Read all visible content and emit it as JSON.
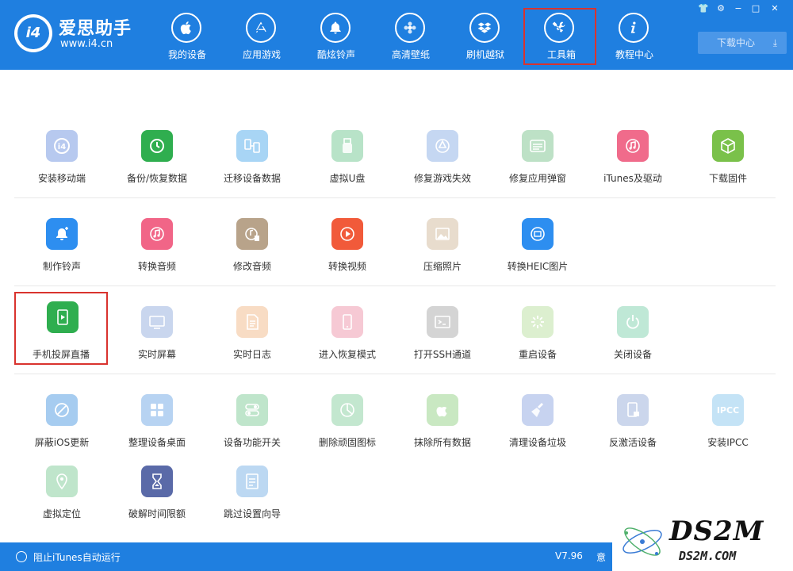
{
  "app": {
    "brand_name": "爱思助手",
    "brand_url": "www.i4.cn",
    "logo_text": "i4"
  },
  "nav": {
    "items": [
      {
        "label": "我的设备",
        "icon": "apple-icon"
      },
      {
        "label": "应用游戏",
        "icon": "app-store-icon"
      },
      {
        "label": "酷炫铃声",
        "icon": "bell-icon"
      },
      {
        "label": "高清壁纸",
        "icon": "flower-icon"
      },
      {
        "label": "刷机越狱",
        "icon": "box-icon"
      },
      {
        "label": "工具箱",
        "icon": "tools-icon",
        "active": true
      },
      {
        "label": "教程中心",
        "icon": "info-icon"
      }
    ],
    "download_center": "下载中心",
    "download_arrow": "⤓"
  },
  "window": {
    "shirt": "👕",
    "gear": "⚙",
    "minimize": "−",
    "maximize": "□",
    "close": "✕"
  },
  "tools": {
    "row1": [
      {
        "label": "安装移动端",
        "color": "#b7c9ef"
      },
      {
        "label": "备份/恢复数据",
        "color": "#2fae4f"
      },
      {
        "label": "迁移设备数据",
        "color": "#a8d5f5"
      },
      {
        "label": "虚拟U盘",
        "color": "#b8e3c8"
      },
      {
        "label": "修复游戏失效",
        "color": "#c5d7f2"
      },
      {
        "label": "修复应用弹窗",
        "color": "#bde1c6"
      },
      {
        "label": "iTunes及驱动",
        "color": "#f06b8b"
      },
      {
        "label": "下载固件",
        "color": "#7ac14a"
      }
    ],
    "row2": [
      {
        "label": "制作铃声",
        "color": "#2d8ef0"
      },
      {
        "label": "转换音频",
        "color": "#f16587"
      },
      {
        "label": "修改音频",
        "color": "#b8a38a"
      },
      {
        "label": "转换视频",
        "color": "#f15a3a"
      },
      {
        "label": "压缩照片",
        "color": "#e8dccd"
      },
      {
        "label": "转换HEIC图片",
        "color": "#2d8ef0"
      }
    ],
    "row3": [
      {
        "label": "手机投屏直播",
        "color": "#2fae4f"
      },
      {
        "label": "实时屏幕",
        "color": "#c9d6ee"
      },
      {
        "label": "实时日志",
        "color": "#f8dcc4"
      },
      {
        "label": "进入恢复模式",
        "color": "#f6c9d4"
      },
      {
        "label": "打开SSH通道",
        "color": "#d4d4d4"
      },
      {
        "label": "重启设备",
        "color": "#dcefcf"
      },
      {
        "label": "关闭设备",
        "color": "#bfe8d6"
      }
    ],
    "row4": [
      {
        "label": "屏蔽iOS更新",
        "color": "#a6ccf0"
      },
      {
        "label": "整理设备桌面",
        "color": "#b7d3f2"
      },
      {
        "label": "设备功能开关",
        "color": "#bfe5cb"
      },
      {
        "label": "删除顽固图标",
        "color": "#c3e7cf"
      },
      {
        "label": "抹除所有数据",
        "color": "#c9e8c2"
      },
      {
        "label": "清理设备垃圾",
        "color": "#c7d3f0"
      },
      {
        "label": "反激活设备",
        "color": "#cbd6ec"
      },
      {
        "label": "安装IPCC",
        "color": "#c4e3f6",
        "text": "IPCC"
      }
    ],
    "row5": [
      {
        "label": "虚拟定位",
        "color": "#bfe5cb"
      },
      {
        "label": "破解时间限额",
        "color": "#5a6aa8"
      },
      {
        "label": "跳过设置向导",
        "color": "#bcd8f2"
      }
    ]
  },
  "footer": {
    "itunes_toggle": "阻止iTunes自动运行",
    "version": "V7.96",
    "more": "意"
  },
  "watermark": {
    "big": "DS2M",
    "small": "DS2M.COM"
  }
}
